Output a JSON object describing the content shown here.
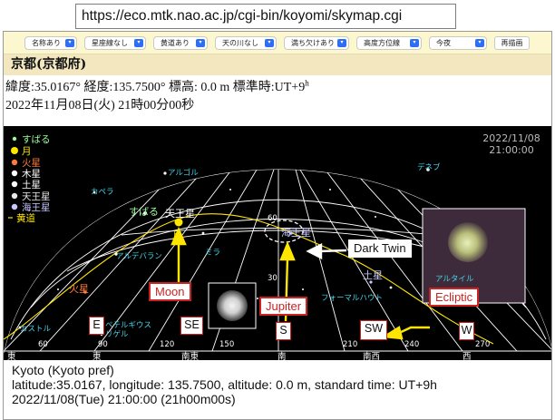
{
  "browser": {
    "url": "https://eco.mtk.nao.ac.jp/cgi-bin/koyomi/skymap.cgi"
  },
  "toolbar": {
    "selects": [
      "名称あり",
      "星座線なし",
      "黄道あり",
      "天の川なし",
      "満ち欠けあり",
      "高度方位線",
      "今夜"
    ],
    "redraw_label": "再描画"
  },
  "header": {
    "title": "京都(京都府)",
    "coords": "緯度:35.0167° 経度:135.7500° 標高: 0.0 m 標準時:UT+9",
    "tz_sup": "h",
    "datetime": "2022年11月08日(火) 21時00分00秒"
  },
  "skymap": {
    "stamp_date": "2022/11/08",
    "stamp_time": "21:00:00",
    "legend": [
      "すばる",
      "月",
      "火星",
      "木星",
      "土星",
      "天王星",
      "海王星",
      "黄道"
    ],
    "legend_colors": [
      "#ffffff",
      "#ffe600",
      "#ff7b3a",
      "#ffffff",
      "#ffffff",
      "#e8e8e8",
      "#c7c7ff",
      "#ffe600"
    ],
    "star_names": [
      "アルゴル",
      "デネブ",
      "カペラ",
      "アルデバラン",
      "ミラ",
      "アルタイル",
      "フォーマルハウト",
      "ベテルギウス",
      "リゲル",
      "カストル"
    ],
    "object_labels": {
      "subaru": "すばる",
      "uranus": "天王星",
      "moon": "月",
      "mars": "火星",
      "neptune": "海王星",
      "saturn": "土星"
    },
    "alt_labels": [
      "60",
      "30"
    ],
    "az_labels": [
      "60",
      "90",
      "120",
      "150",
      "210",
      "240",
      "270"
    ],
    "dir_labels": [
      "東",
      "東",
      "南東",
      "南",
      "南西",
      "西"
    ]
  },
  "annotations": {
    "moon": "Moon",
    "jupiter": "Jupiter",
    "ecliptic": "Ecliptic",
    "dark_twin": "Dark Twin",
    "dirs": [
      "E",
      "SE",
      "S",
      "SW",
      "W"
    ]
  },
  "caption": {
    "line1": "Kyoto (Kyoto pref)",
    "line2": "latitude:35.0167, longitude: 135.7500, altitude: 0.0 m, standard time: UT+9h",
    "line3": "2022/11/08(Tue) 21:00:00 (21h00m00s)"
  }
}
